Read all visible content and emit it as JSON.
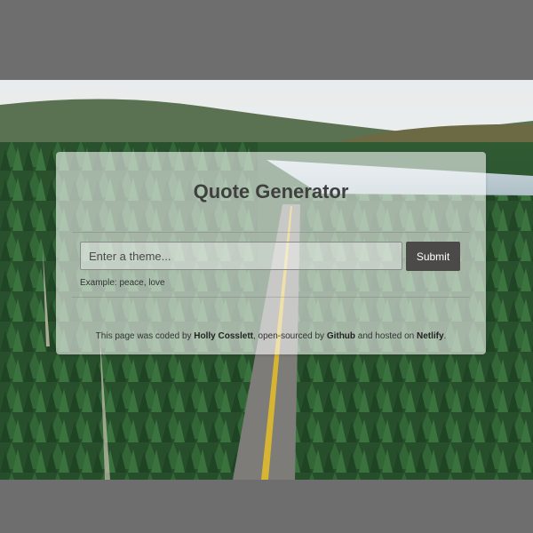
{
  "app": {
    "title": "Quote Generator"
  },
  "search": {
    "placeholder": "Enter a theme...",
    "value": "",
    "submit_label": "Submit",
    "example": "Example: peace, love"
  },
  "footer": {
    "text_1": "This page was coded by ",
    "author": "Holly Cosslett",
    "text_2": ", open-sourced by ",
    "source_link": "Github",
    "text_3": " and hosted on ",
    "host_link": "Netlify",
    "text_4": "."
  },
  "colors": {
    "page_background": "#6e6e6e",
    "card_background": "rgba(255,255,255,0.58)",
    "button_background": "#4b4a48",
    "title_color": "#3f3f3f"
  },
  "background": {
    "icon": "forest-road-photo"
  }
}
